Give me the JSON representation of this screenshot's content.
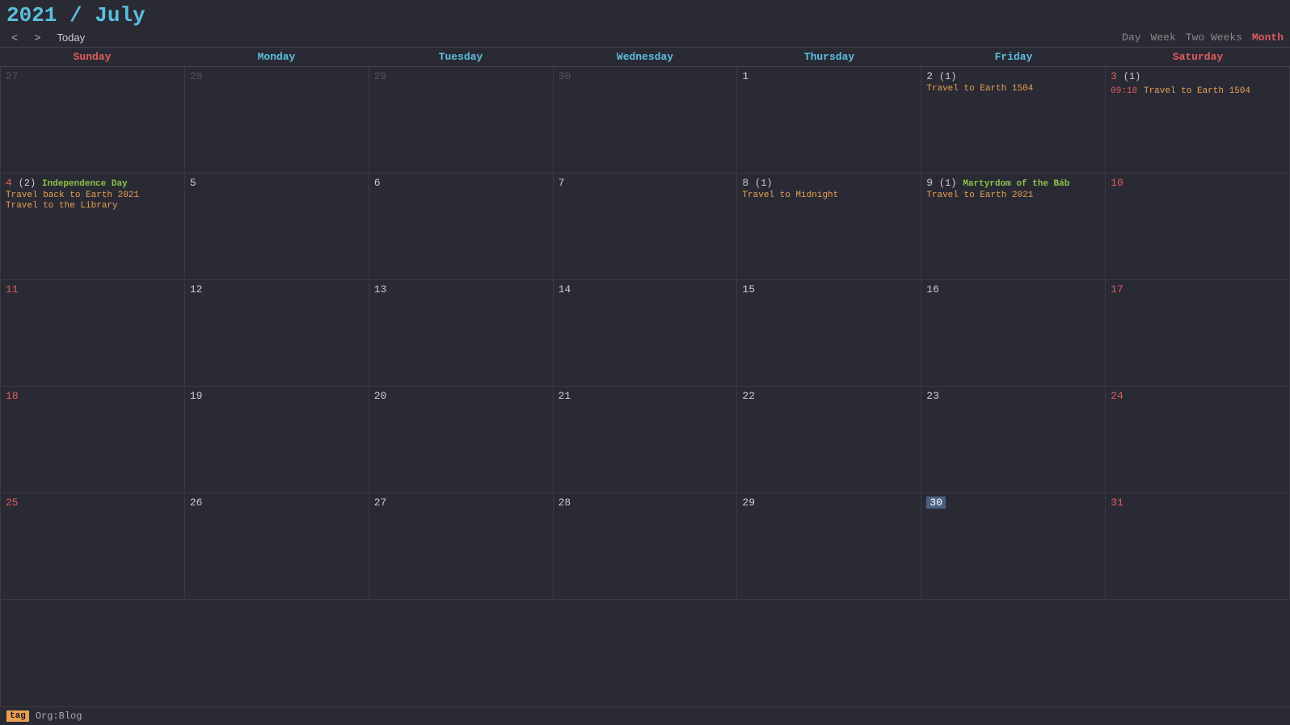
{
  "header": {
    "year": "2021",
    "separator": " / ",
    "month": "July",
    "title": "2021 / July"
  },
  "nav": {
    "prev": "<",
    "next": ">",
    "today": "Today"
  },
  "views": {
    "day": "Day",
    "week": "Week",
    "two_weeks": "Two Weeks",
    "month": "Month",
    "active": "Month"
  },
  "day_headers": [
    {
      "label": "Sunday",
      "type": "weekend"
    },
    {
      "label": "Monday",
      "type": "weekday"
    },
    {
      "label": "Tuesday",
      "type": "weekday"
    },
    {
      "label": "Wednesday",
      "type": "weekday"
    },
    {
      "label": "Thursday",
      "type": "weekday"
    },
    {
      "label": "Friday",
      "type": "weekday"
    },
    {
      "label": "Saturday",
      "type": "weekend"
    }
  ],
  "weeks": [
    {
      "days": [
        {
          "num": "27",
          "other": true,
          "dow": "sunday"
        },
        {
          "num": "28",
          "other": true,
          "dow": "monday"
        },
        {
          "num": "29",
          "other": true,
          "dow": "tuesday"
        },
        {
          "num": "30",
          "other": true,
          "dow": "wednesday"
        },
        {
          "num": "1",
          "dow": "thursday",
          "events": []
        },
        {
          "num": "2",
          "dow": "friday",
          "count": "(1)",
          "events": [
            {
              "text": "Travel to Earth 1504",
              "type": "travel"
            }
          ]
        },
        {
          "num": "3",
          "dow": "saturday",
          "count": "(1)",
          "events": [
            {
              "time": "09:18",
              "text": "Travel to Earth 1504",
              "type": "travel"
            }
          ]
        }
      ]
    },
    {
      "days": [
        {
          "num": "4",
          "dow": "sunday",
          "count": "(2)",
          "events": [
            {
              "text": "Independence Day",
              "type": "holiday"
            },
            {
              "text": "Travel back to Earth 2021",
              "type": "travel"
            },
            {
              "text": "Travel to the Library",
              "type": "travel"
            }
          ]
        },
        {
          "num": "5",
          "dow": "monday"
        },
        {
          "num": "6",
          "dow": "tuesday"
        },
        {
          "num": "7",
          "dow": "wednesday"
        },
        {
          "num": "8",
          "dow": "thursday",
          "count": "(1)",
          "events": [
            {
              "text": "Travel to Midnight",
              "type": "travel"
            }
          ]
        },
        {
          "num": "9",
          "dow": "friday",
          "count": "(1)",
          "events": [
            {
              "text": "Martyrdom of the Báb",
              "type": "holiday"
            },
            {
              "text": "Travel to Earth 2021",
              "type": "travel"
            }
          ]
        },
        {
          "num": "10",
          "dow": "saturday"
        }
      ]
    },
    {
      "days": [
        {
          "num": "11",
          "dow": "sunday"
        },
        {
          "num": "12",
          "dow": "monday"
        },
        {
          "num": "13",
          "dow": "tuesday"
        },
        {
          "num": "14",
          "dow": "wednesday"
        },
        {
          "num": "15",
          "dow": "thursday"
        },
        {
          "num": "16",
          "dow": "friday"
        },
        {
          "num": "17",
          "dow": "saturday"
        }
      ]
    },
    {
      "days": [
        {
          "num": "18",
          "dow": "sunday"
        },
        {
          "num": "19",
          "dow": "monday"
        },
        {
          "num": "20",
          "dow": "tuesday"
        },
        {
          "num": "21",
          "dow": "wednesday"
        },
        {
          "num": "22",
          "dow": "thursday"
        },
        {
          "num": "23",
          "dow": "friday"
        },
        {
          "num": "24",
          "dow": "saturday"
        }
      ]
    },
    {
      "days": [
        {
          "num": "25",
          "dow": "sunday"
        },
        {
          "num": "26",
          "dow": "monday"
        },
        {
          "num": "27",
          "dow": "tuesday"
        },
        {
          "num": "28",
          "dow": "wednesday"
        },
        {
          "num": "29",
          "dow": "thursday"
        },
        {
          "num": "30",
          "dow": "friday",
          "today": true
        },
        {
          "num": "31",
          "dow": "saturday"
        }
      ]
    }
  ],
  "footer": {
    "tag": "tag",
    "label": "Org:Blog"
  }
}
